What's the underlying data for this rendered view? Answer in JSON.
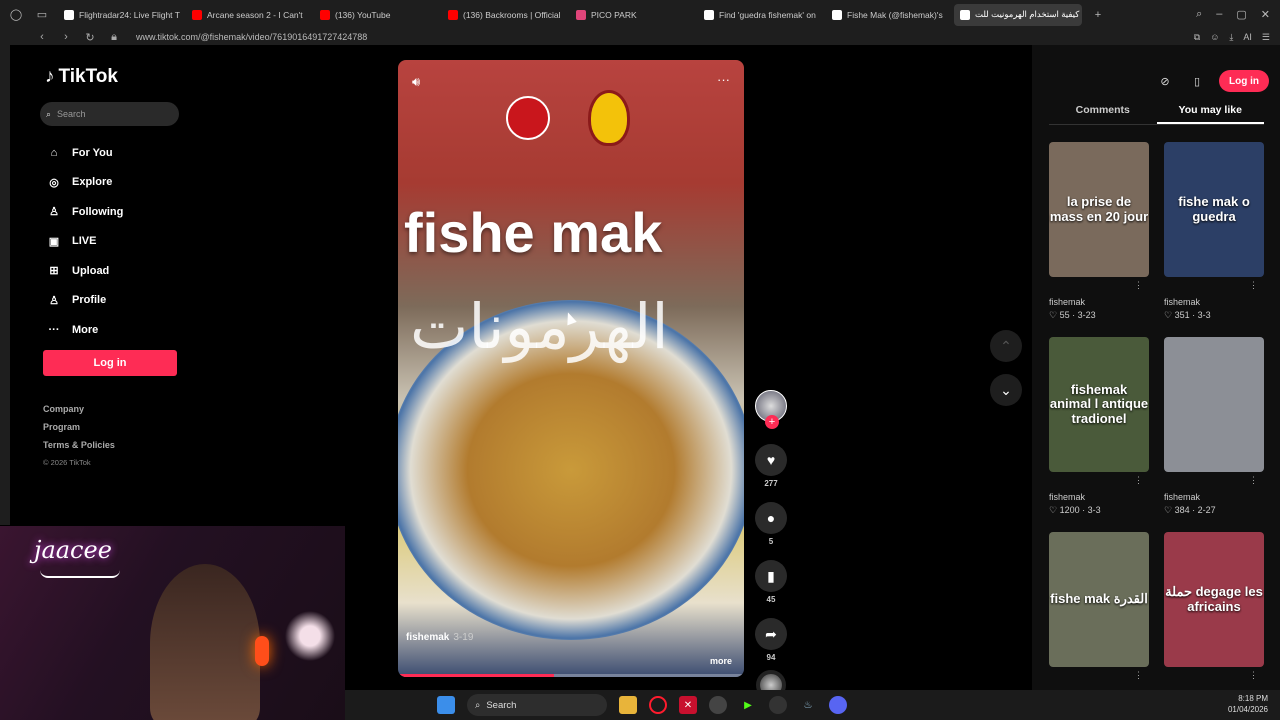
{
  "browser": {
    "tabs": [
      {
        "title": "Flightradar24: Live Flight T",
        "color": "#ffffff"
      },
      {
        "title": "Arcane season 2 - I Can't",
        "color": "#ff0000"
      },
      {
        "title": "(136) YouTube",
        "color": "#ff0000"
      },
      {
        "title": "(136) Backrooms | Official",
        "color": "#ff0000"
      },
      {
        "title": "PICO PARK",
        "color": "#e0457a"
      },
      {
        "title": "Find 'guedra fishemak' on",
        "color": "#ffffff"
      },
      {
        "title": "Fishe Mak (@fishemak)'s",
        "color": "#ffffff"
      },
      {
        "title": "كيفية استخدام الهرمونيت للت",
        "color": "#ffffff"
      }
    ],
    "url": "www.tiktok.com/@fishemak/video/7619016491727424788",
    "ai_label": "AI"
  },
  "sidebar": {
    "logo": "TikTok",
    "search_placeholder": "Search",
    "nav": [
      {
        "label": "For You",
        "icon": "home-icon",
        "glyph": "⌂"
      },
      {
        "label": "Explore",
        "icon": "compass-icon",
        "glyph": "◎"
      },
      {
        "label": "Following",
        "icon": "following-icon",
        "glyph": "♙"
      },
      {
        "label": "LIVE",
        "icon": "live-icon",
        "glyph": "▣"
      },
      {
        "label": "Upload",
        "icon": "upload-icon",
        "glyph": "⊞"
      },
      {
        "label": "Profile",
        "icon": "profile-icon",
        "glyph": "♙"
      },
      {
        "label": "More",
        "icon": "more-icon",
        "glyph": "···"
      }
    ],
    "login_label": "Log in",
    "footer": {
      "company": "Company",
      "program": "Program",
      "terms": "Terms & Policies",
      "copyright": "© 2026 TikTok"
    }
  },
  "video": {
    "overlay_title": "fishe mak",
    "overlay_arabic": "الهرمونات",
    "author": "fishemak",
    "date": "3-19",
    "more_label": "more",
    "progress": 0.45
  },
  "actions": {
    "likes": "277",
    "comments": "5",
    "saves": "45",
    "shares": "94"
  },
  "right": {
    "login_label": "Log in",
    "tabs": [
      "Comments",
      "You may like"
    ],
    "active_tab": "You may like",
    "cards": [
      {
        "overlay": "la prise de mass en 20 jour",
        "author": "fishemak",
        "likes": "55",
        "date": "3-23",
        "bg": "#7a6a5c"
      },
      {
        "overlay": "fishe mak o guedra",
        "author": "fishemak",
        "likes": "351",
        "date": "3-3",
        "bg": "#2c3f66"
      },
      {
        "overlay": "fishemak animal l antique tradionel",
        "author": "fishemak",
        "likes": "1200",
        "date": "3-3",
        "bg": "#4a5a3a"
      },
      {
        "overlay": "",
        "author": "fishemak",
        "likes": "384",
        "date": "2-27",
        "bg": "#8c8f96"
      },
      {
        "overlay": "fishe mak القدرة",
        "author": "",
        "likes": "",
        "date": "",
        "bg": "#6a6e5a"
      },
      {
        "overlay": "حملة degage les africains",
        "author": "",
        "likes": "",
        "date": "",
        "bg": "#9a3a4a"
      }
    ]
  },
  "webcam": {
    "name": "jaacee"
  },
  "taskbar": {
    "search_label": "Search",
    "time": "8:18 PM",
    "date": "01/04/2026"
  },
  "colors": {
    "accent": "#fe2c55"
  }
}
